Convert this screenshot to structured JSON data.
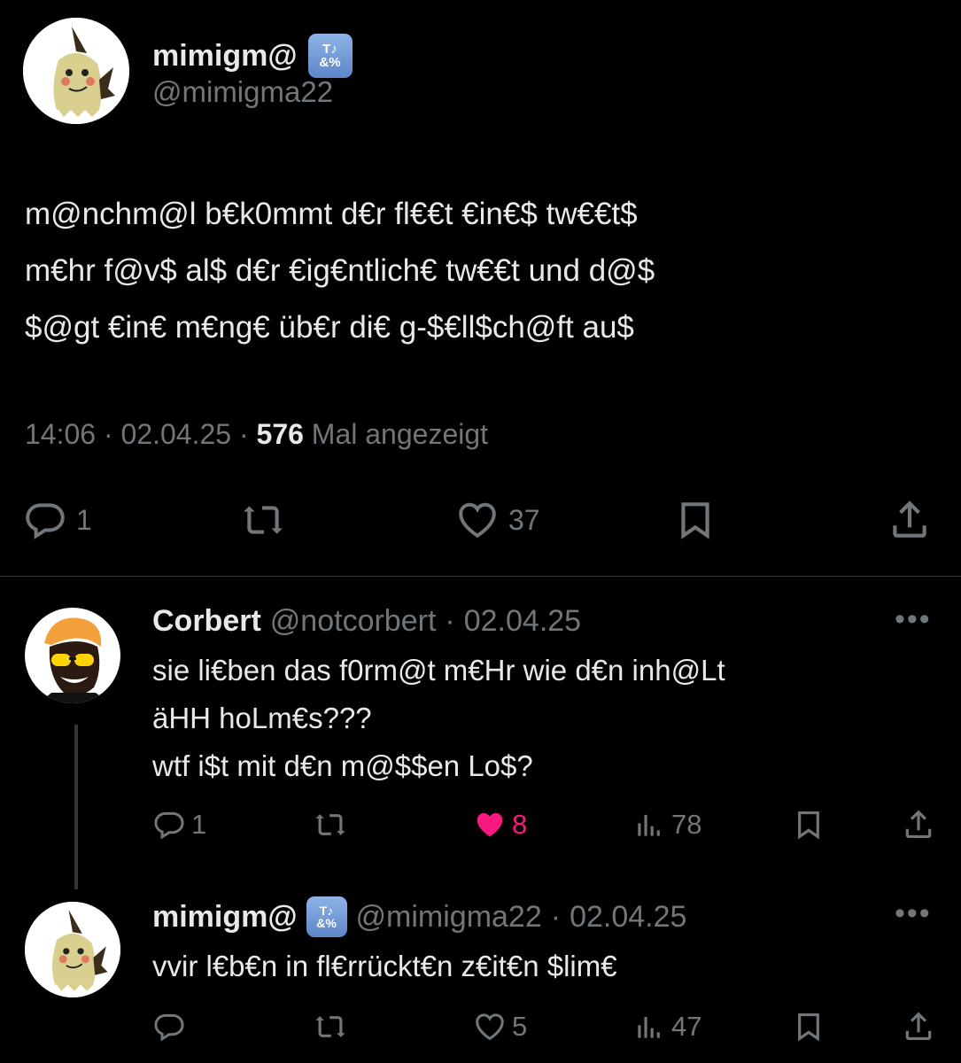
{
  "main_tweet": {
    "display_name": "mimigm@",
    "handle": "@mimigma22",
    "badge": "™♪&%",
    "text": "m@nchm@l b€k0mmt d€r fl€€t €in€$ tw€€t$\nm€hr f@v$ al$ d€r €ig€ntlich€ tw€€t und d@$\n$@gt €in€ m€ng€ üb€r di€ g-$€ll$ch@ft au$",
    "time": "14:06",
    "date": "02.04.25",
    "views": "576",
    "views_label": "Mal angezeigt",
    "replies": "1",
    "likes": "37"
  },
  "replies": [
    {
      "display_name": "Corbert",
      "handle": "@notcorbert",
      "date": "02.04.25",
      "text": "sie li€ben das f0rm@t m€Hr wie d€n inh@Lt\näHH hoLm€s???\nwtf i$t mit d€n m@$$en Lo$?",
      "replies": "1",
      "likes": "8",
      "views": "78",
      "liked": true
    },
    {
      "display_name": "mimigm@",
      "handle": "@mimigma22",
      "date": "02.04.25",
      "text": "vvir l€b€n in fl€rrückt€n z€it€n $lim€",
      "replies": "",
      "likes": "5",
      "views": "47",
      "liked": false
    }
  ],
  "colors": {
    "background": "#000000",
    "text": "#e7e9ea",
    "muted": "#71767b",
    "like_active": "#f91880",
    "divider": "#2f3336"
  },
  "icons": [
    "reply-icon",
    "retweet-icon",
    "like-icon",
    "bookmark-icon",
    "share-icon",
    "views-icon",
    "more-icon"
  ]
}
